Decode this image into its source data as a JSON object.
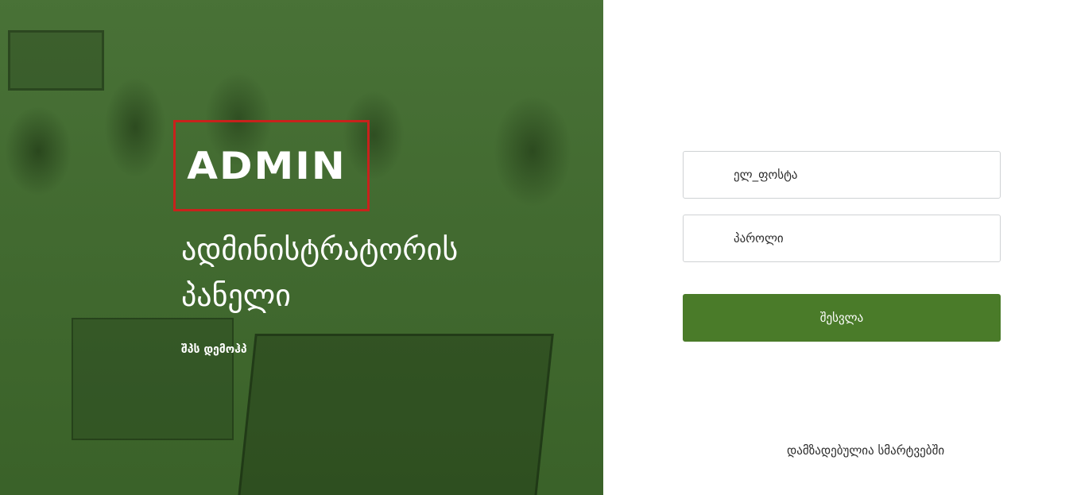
{
  "left_panel": {
    "logo_text": "ADMIN",
    "title": "ადმინისტრატორის პანელი",
    "subtitle": "შპს დემოჰპ",
    "background_color": "#3f6a2c",
    "logo_border_color": "#c8221c"
  },
  "login_form": {
    "email_placeholder": "ელ_ფოსტა",
    "password_placeholder": "პაროლი",
    "submit_label": "შესვლა",
    "button_color": "#4a7b29"
  },
  "footer": {
    "credit": "დამზადებულია სმარტვებში"
  }
}
